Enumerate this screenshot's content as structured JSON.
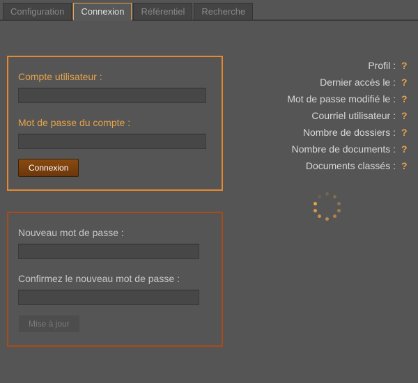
{
  "tabs": {
    "configuration": "Configuration",
    "connexion": "Connexion",
    "referentiel": "Référentiel",
    "recherche": "Recherche"
  },
  "login": {
    "user_label": "Compte utilisateur :",
    "pass_label": "Mot de passe du compte :",
    "user_value": "",
    "pass_value": "",
    "submit": "Connexion"
  },
  "change_pw": {
    "new_label": "Nouveau mot de passe :",
    "confirm_label": "Confirmez le nouveau mot de passe :",
    "new_value": "",
    "confirm_value": "",
    "submit": "Mise à jour"
  },
  "info": {
    "placeholder": "?",
    "items": [
      "Profil :",
      "Dernier accès le :",
      "Mot de passe modifié le :",
      "Courriel utilisateur :",
      "Nombre de dossiers :",
      "Nombre de documents :",
      "Documents classés :"
    ]
  }
}
